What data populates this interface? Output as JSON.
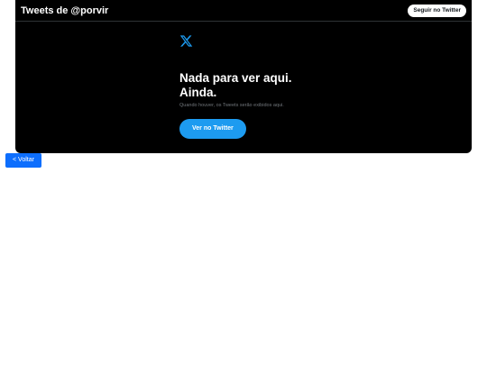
{
  "timeline": {
    "title": "Tweets de @porvir",
    "follow_label": "Seguir no Twitter"
  },
  "empty_state": {
    "logo_icon": "x-logo-icon",
    "title_line1": "Nada para ver aqui.",
    "title_line2": "Ainda.",
    "subtitle": "Quando houver, os Tweets serão exibidos aqui.",
    "view_label": "Ver no Twitter"
  },
  "back_label": "< Voltar",
  "colors": {
    "timeline_bg": "#000000",
    "accent": "#1d9bf0",
    "back_button": "#0d6efd",
    "muted_text": "#71767b"
  }
}
